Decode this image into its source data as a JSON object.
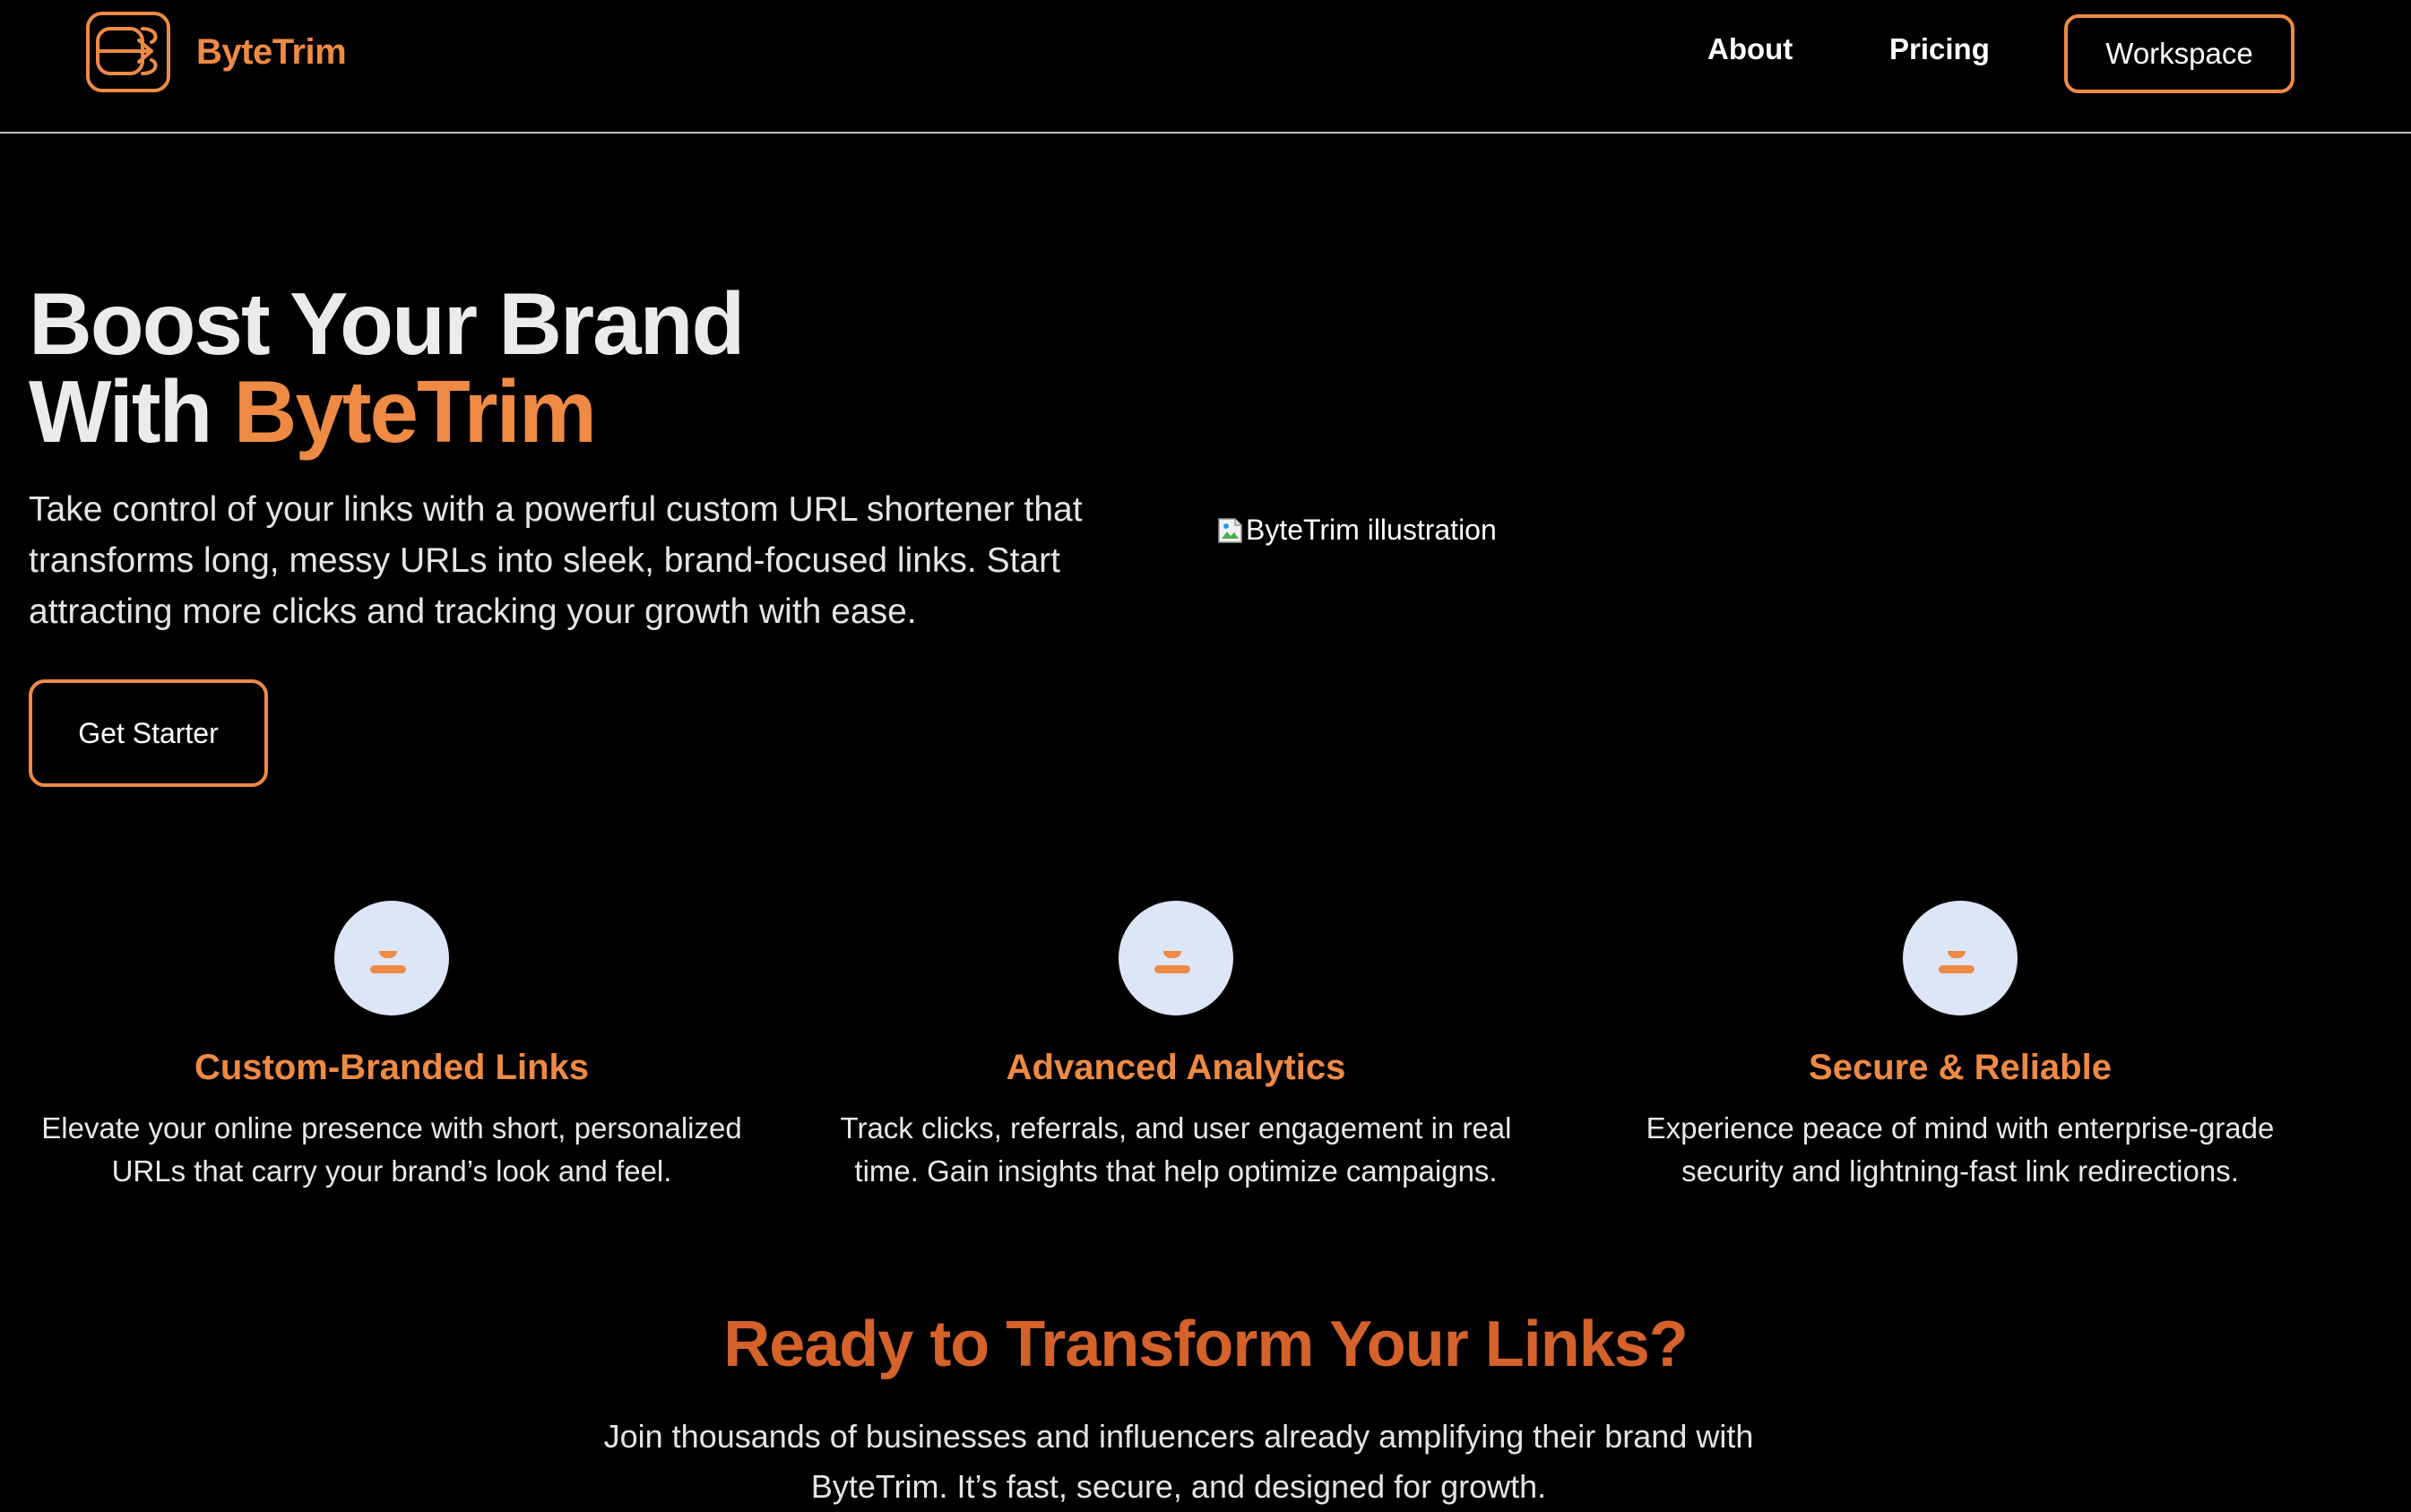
{
  "header": {
    "brand_name": "ByteTrim",
    "logo_icon": "link-arrow-logo-icon",
    "nav": {
      "about": "About",
      "pricing": "Pricing",
      "workspace": "Workspace"
    }
  },
  "hero": {
    "title_line1": "Boost Your Brand",
    "title_line2_prefix": "With ",
    "title_line2_accent": "ByteTrim",
    "description": "Take control of your links with a powerful custom URL shortener that transforms long, messy URLs into sleek, brand-focused links. Start attracting more clicks and tracking your growth with ease.",
    "cta_label": "Get Starter",
    "image_alt": "ByteTrim illustration"
  },
  "features": [
    {
      "icon": "feature-icon",
      "title": "Custom-Branded Links",
      "description": "Elevate your online presence with short, personalized URLs that carry your brand’s look and feel."
    },
    {
      "icon": "feature-icon",
      "title": "Advanced Analytics",
      "description": "Track clicks, referrals, and user engagement in real time. Gain insights that help optimize campaigns."
    },
    {
      "icon": "feature-icon",
      "title": "Secure & Reliable",
      "description": "Experience peace of mind with enterprise-grade security and lightning-fast link redirections."
    }
  ],
  "cta_section": {
    "title": "Ready to Transform Your Links?",
    "description": "Join thousands of businesses and influencers already amplifying their brand with ByteTrim. It’s fast, secure, and designed for growth."
  },
  "colors": {
    "background": "#000000",
    "accent": "#ee8a44",
    "accent_dark": "#d4622a",
    "icon_circle": "#dde6f7",
    "text": "#ffffff"
  }
}
